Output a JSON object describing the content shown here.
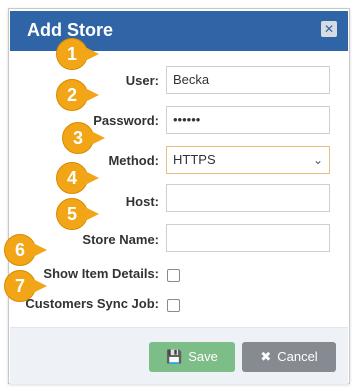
{
  "dialog": {
    "title": "Add Store",
    "close_icon": "close-icon",
    "fields": {
      "user": {
        "label": "User:",
        "value": "Becka"
      },
      "password": {
        "label": "Password:",
        "value": "••••••"
      },
      "method": {
        "label": "Method:",
        "value": "HTTPS"
      },
      "host": {
        "label": "Host:",
        "value": ""
      },
      "store_name": {
        "label": "Store Name:",
        "value": ""
      },
      "show_item_details": {
        "label": "Show Item Details:"
      },
      "customers_sync_job": {
        "label": "Customers Sync Job:"
      }
    },
    "buttons": {
      "save": {
        "label": "Save",
        "icon": "save-icon"
      },
      "cancel": {
        "label": "Cancel",
        "icon": "close-icon"
      }
    }
  },
  "callouts": [
    "1",
    "2",
    "3",
    "4",
    "5",
    "6",
    "7"
  ],
  "colors": {
    "header": "#2f64a6",
    "save_button": "#7dbd88",
    "cancel_button": "#858b91",
    "callout": "#f2a516"
  }
}
